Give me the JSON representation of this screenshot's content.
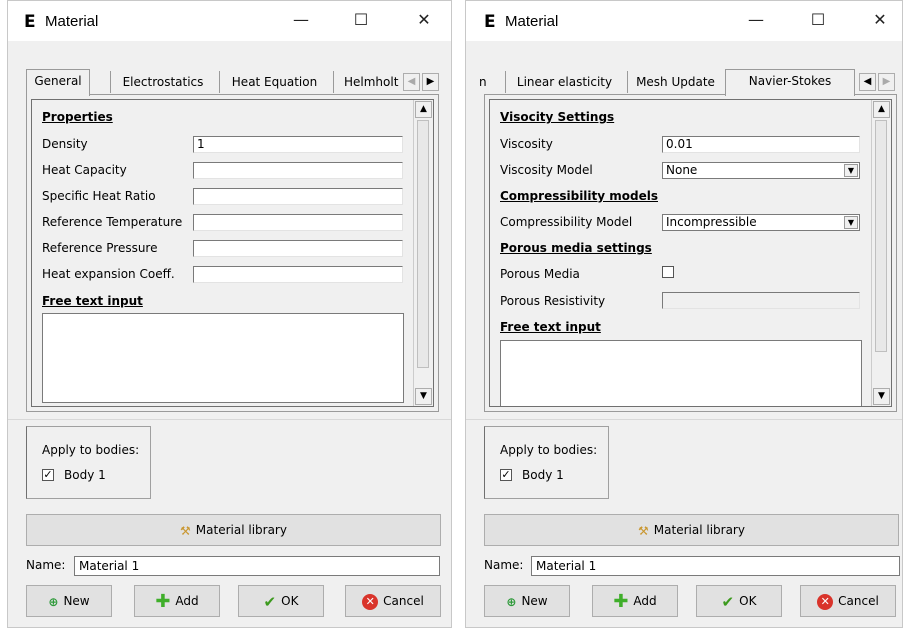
{
  "left": {
    "app_icon": "E",
    "title": "Material",
    "tabs": [
      "General",
      "Electrostatics",
      "Heat Equation",
      "Helmholt"
    ],
    "properties_heading": "Properties",
    "fields": [
      {
        "label": "Density",
        "value": "1"
      },
      {
        "label": "Heat Capacity",
        "value": ""
      },
      {
        "label": "Specific Heat Ratio",
        "value": ""
      },
      {
        "label": "Reference Temperature",
        "value": ""
      },
      {
        "label": "Reference Pressure",
        "value": ""
      },
      {
        "label": "Heat expansion Coeff.",
        "value": ""
      }
    ],
    "free_text_heading": "Free text input",
    "apply_label": "Apply to bodies:",
    "body_label": "Body 1",
    "body_checked": true,
    "library_button": "Material library",
    "name_label": "Name:",
    "name_value": "Material 1",
    "buttons": {
      "new": "New",
      "add": "Add",
      "ok": "OK",
      "cancel": "Cancel"
    }
  },
  "right": {
    "app_icon": "E",
    "title": "Material",
    "tabs": [
      "n",
      "Linear elasticity",
      "Mesh Update",
      "Navier-Stokes"
    ],
    "viscosity_heading": "Visocity Settings",
    "viscosity_label": "Viscosity",
    "viscosity_value": "0.01",
    "viscosity_model_label": "Viscosity Model",
    "viscosity_model_value": "None",
    "compress_heading": "Compressibility models",
    "compress_label": "Compressibility Model",
    "compress_value": "Incompressible",
    "porous_heading": "Porous media settings",
    "porous_media_label": "Porous Media",
    "porous_media_checked": false,
    "porous_resistivity_label": "Porous Resistivity",
    "porous_resistivity_value": "",
    "free_text_heading": "Free text input",
    "apply_label": "Apply to bodies:",
    "body_label": "Body 1",
    "body_checked": true,
    "library_button": "Material library",
    "name_label": "Name:",
    "name_value": "Material 1",
    "buttons": {
      "new": "New",
      "add": "Add",
      "ok": "OK",
      "cancel": "Cancel"
    }
  },
  "window_controls": {
    "minimize": "—",
    "maximize": "☐",
    "close": "✕"
  },
  "colors": {
    "add_green": "#3fae2a",
    "ok_green": "#3c9a1e",
    "cancel_red": "#d9342b",
    "new_green": "#2e9a3a"
  }
}
